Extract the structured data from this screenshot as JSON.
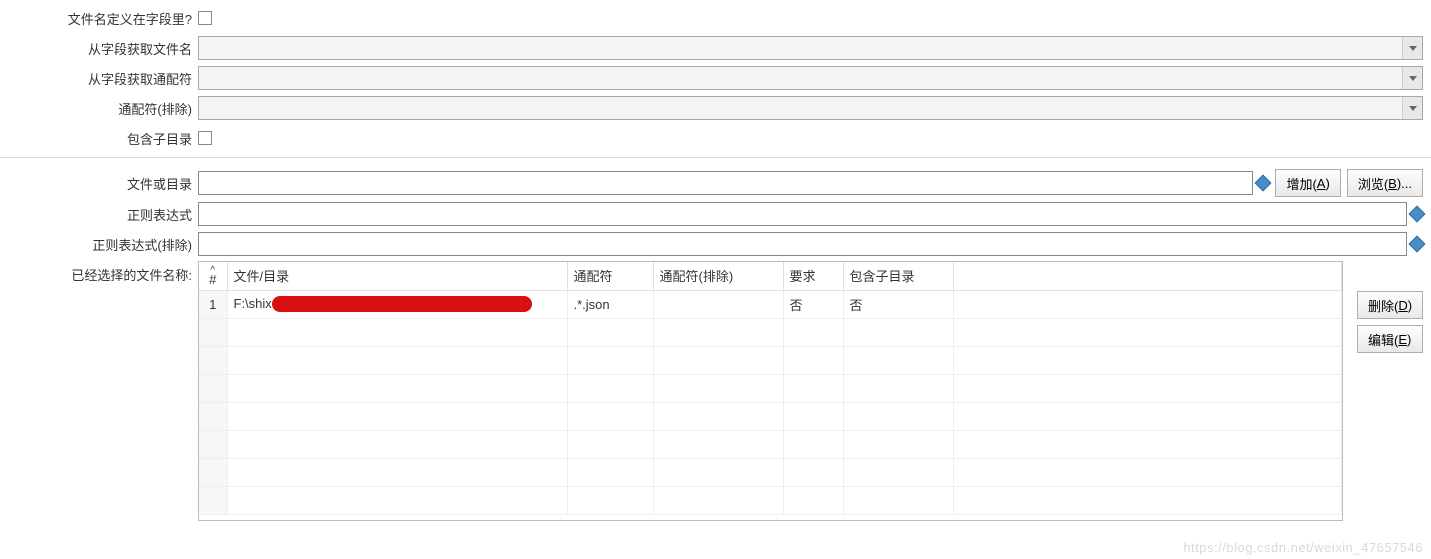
{
  "labels": {
    "filename_in_field": "文件名定义在字段里?",
    "get_filename_from_field": "从字段获取文件名",
    "get_wildcard_from_field": "从字段获取通配符",
    "wildcard_exclude": "通配符(排除)",
    "include_subdir": "包含子目录",
    "file_or_dir": "文件或目录",
    "regex": "正则表达式",
    "regex_exclude": "正则表达式(排除)",
    "selected_filenames": "已经选择的文件名称:"
  },
  "buttons": {
    "add_text": "增加(",
    "add_accel": "A",
    "add_suffix": ")",
    "browse_text": "浏览(",
    "browse_accel": "B",
    "browse_suffix": ")...",
    "delete_text": "删除(",
    "delete_accel": "D",
    "delete_suffix": ")",
    "edit_text": "编辑(",
    "edit_accel": "E",
    "edit_suffix": ")"
  },
  "inputs": {
    "file_or_dir": "",
    "regex": "",
    "regex_exclude": ""
  },
  "table": {
    "headers": {
      "hash": "#",
      "path": "文件/目录",
      "wildcard": "通配符",
      "wildcard_exclude": "通配符(排除)",
      "required": "要求",
      "include_sub": "包含子目录"
    },
    "rows": [
      {
        "num": "1",
        "path_prefix": "F:\\shix",
        "wildcard": ".*.json",
        "wildcard_exclude": "",
        "required": "否",
        "include_sub": "否"
      }
    ]
  },
  "watermark": "https://blog.csdn.net/weixin_47657546"
}
